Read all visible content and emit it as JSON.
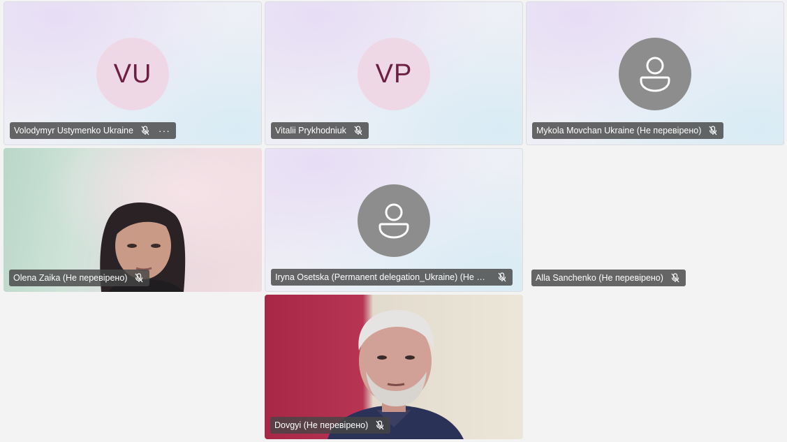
{
  "participants": [
    {
      "name": "Volodymyr Ustymenko Ukraine",
      "initials": "VU",
      "muted": true,
      "more_icon": "···"
    },
    {
      "name": "Vitalii Prykhodniuk",
      "initials": "VP",
      "muted": true
    },
    {
      "name": "Mykola Movchan Ukraine (Не перевірено)",
      "avatar": "generic-person-icon",
      "muted": true
    },
    {
      "name": "Olena Zaika (Не перевірено)",
      "video": true,
      "muted": true
    },
    {
      "name": "Iryna Osetska (Permanent delegation_Ukraine) (Не перевірено)",
      "avatar": "generic-person-icon",
      "muted": true
    },
    {
      "name": "Alla Sanchenko (Не перевірено)",
      "video": false,
      "muted": true
    },
    {
      "name": "Dovgyi (Не перевірено)",
      "video": true,
      "muted": true
    }
  ],
  "colors": {
    "initials_bg": "#efd8e6",
    "initials_fg": "#6c1f43",
    "generic_avatar_bg": "#8d8d8d",
    "nameplate_bg": "#464646"
  }
}
